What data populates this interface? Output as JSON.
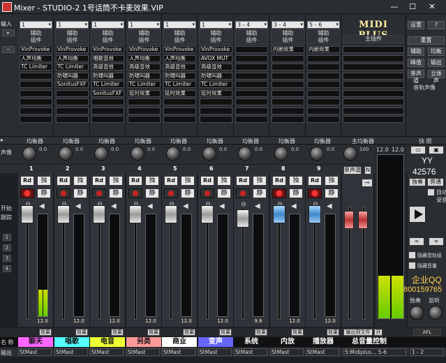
{
  "window": {
    "title": "Mixer - STUDIO-2   1号话筒不卡麦效果.VIP",
    "minimize": "—",
    "maximize": "☐",
    "close": "✕"
  },
  "left_sidebar": {
    "input_label": "输入",
    "pan_label": "声像",
    "start_label": "开始",
    "track_label": "跟踪",
    "num_buttons": [
      "1",
      "2",
      "3",
      "4"
    ],
    "name_label": "名 称",
    "output_label": "输出"
  },
  "channels": [
    {
      "num": "1",
      "input": "1",
      "send": "辅助",
      "plugin": "插件",
      "slots": [
        "VinProvoke",
        "人声均衡",
        "TC Limiter",
        "",
        "",
        "",
        "",
        "",
        ""
      ],
      "eq": "均衡器",
      "pan": "0.0",
      "rec_on": true,
      "name": "聊天",
      "name_color": "#ff66ff",
      "name_text": "#111",
      "output": "StMast",
      "fx": "效果",
      "level": 0.26,
      "peak": "12.0"
    },
    {
      "num": "2",
      "input": "1",
      "send": "辅助",
      "plugin": "插件",
      "slots": [
        "VinProvoke",
        "人声均衡",
        "TC Limiter",
        "防啸叫器",
        "SonitusFXF",
        "",
        "",
        "",
        ""
      ],
      "eq": "均衡器",
      "pan": "0.0",
      "rec_on": false,
      "name": "唱歌",
      "name_color": "#55ffff",
      "name_text": "#111",
      "output": "StMast",
      "fx": "效果",
      "level": 0,
      "peak": "12.0"
    },
    {
      "num": "3",
      "input": "1",
      "send": "辅助",
      "plugin": "插件",
      "slots": [
        "VinProvoke",
        "唱歌音效",
        "高级音效",
        "防啸叫器",
        "TC Limiter",
        "SonitusFXF",
        "",
        "",
        ""
      ],
      "eq": "均衡器",
      "pan": "0.0",
      "rec_on": false,
      "name": "电音",
      "name_color": "#eeff33",
      "name_text": "#111",
      "output": "StMast",
      "fx": "效果",
      "level": 0,
      "peak": "12.0"
    },
    {
      "num": "4",
      "input": "1",
      "send": "辅助",
      "plugin": "插件",
      "slots": [
        "VinProvoke",
        "人声均衡",
        "高级音效",
        "防啸叫器",
        "TC Limiter",
        "延时效果",
        "",
        "",
        ""
      ],
      "eq": "均衡器",
      "pan": "0.0",
      "rec_on": false,
      "name": "另类",
      "name_color": "#ff9999",
      "name_text": "#111",
      "output": "StMast",
      "fx": "效果",
      "level": 0,
      "peak": "12.0"
    },
    {
      "num": "5",
      "input": "1",
      "send": "辅助",
      "plugin": "插件",
      "slots": [
        "VinProvoke",
        "人声均衡",
        "高级音效",
        "防啸叫器",
        "TC Limiter",
        "延时效果",
        "",
        "",
        ""
      ],
      "eq": "均衡器",
      "pan": "0.0",
      "rec_on": false,
      "name": "商业",
      "name_color": "#ffffff",
      "name_text": "#111",
      "output": "StMast",
      "fx": "效果",
      "level": 0,
      "peak": "12.0"
    },
    {
      "num": "6",
      "input": "1",
      "send": "辅助",
      "plugin": "插件",
      "slots": [
        "VinProvoke",
        "AVOX MUT",
        "高级音效",
        "防啸叫器",
        "TC Limiter",
        "延时效果",
        "",
        "",
        ""
      ],
      "eq": "均衡器",
      "pan": "0.0",
      "rec_on": false,
      "name": "变声",
      "name_color": "#6666ff",
      "name_text": "#fff",
      "output": "StMast",
      "fx": "效果",
      "level": 0,
      "peak": "12.0"
    },
    {
      "num": "7",
      "input": "3 - 4",
      "send": "辅助",
      "plugin": "插件",
      "slots": [
        "",
        "",
        "",
        "",
        "",
        "",
        "",
        "",
        ""
      ],
      "eq": "均衡器",
      "pan": "0.0",
      "rec_on": false,
      "name": "系统",
      "name_color": "#111111",
      "name_text": "#fff",
      "output": "StMast",
      "fx": "效果",
      "level": 0,
      "peak": "9.8"
    },
    {
      "num": "8",
      "input": "3 - 4",
      "send": "辅助",
      "plugin": "插件",
      "slots": [
        "内嵌效果",
        "",
        "",
        "",
        "",
        "",
        "",
        "",
        ""
      ],
      "eq": "均衡器",
      "pan": "0.0",
      "rec_on": true,
      "name": "内放",
      "name_color": "#111111",
      "name_text": "#fff",
      "output": "StMast",
      "fx": "效果",
      "level": 0,
      "peak": "12.0"
    },
    {
      "num": "9",
      "input": "5 - 6",
      "send": "辅助",
      "plugin": "插件",
      "slots": [
        "内嵌效果",
        "",
        "",
        "",
        "",
        "",
        "",
        "",
        ""
      ],
      "eq": "均衡器",
      "pan": "0.0",
      "rec_on": true,
      "name": "播放器",
      "name_color": "#111111",
      "name_text": "#fff",
      "output": "StMast",
      "fx": "效果",
      "level": 0,
      "peak": "12.0"
    }
  ],
  "master": {
    "logo": "MIDI PLUS",
    "plugin_header": "主插件",
    "eq": "主均衡器",
    "pan": "100",
    "mono": "单声道",
    "n": "N",
    "output_file": "输出到文件",
    "open": "开",
    "name": "总音量控制",
    "output": "5:Midiplus... 5-6",
    "level_l": 0.26,
    "level_r": 0.26,
    "peak_l": "12.0",
    "peak_r": "12.0"
  },
  "right_panel": {
    "settings": "设置",
    "help": "?",
    "reset": "重置",
    "aux": "辅助",
    "eq": "均衡",
    "sends": "峰值",
    "output": "输出",
    "mono": "单声道",
    "file": "立体声",
    "track_notes": "音轨声像",
    "quick": "快 照",
    "yy": "YY",
    "yy_num": "42576",
    "solo": "独奏",
    "monitor": "旁通",
    "auto": "自动",
    "record": "录音",
    "hide_group": "隐藏音轨组",
    "hide_vol": "隐藏音量",
    "company": "企业QQ",
    "qq": "800159765",
    "solo2": "独奏",
    "listen": "监听",
    "afl": "AFL",
    "out": "1 - 2"
  }
}
